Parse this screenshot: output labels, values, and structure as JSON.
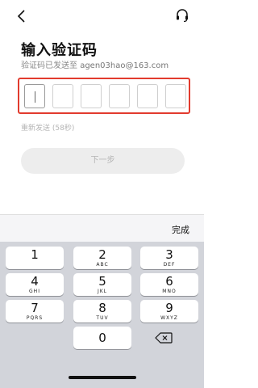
{
  "header": {
    "back_icon": "chevron-left-icon",
    "support_icon": "headset-icon"
  },
  "page": {
    "title": "输入验证码",
    "subtitle_prefix": "验证码已发送至 ",
    "email": "agen03hao@163.com",
    "resend_text": "重新发送 (58秒)",
    "next_label": "下一步"
  },
  "code": {
    "digits": [
      "",
      "",
      "",
      "",
      "",
      ""
    ]
  },
  "keyboard": {
    "done_label": "完成",
    "keys": [
      {
        "num": "1",
        "letters": ""
      },
      {
        "num": "2",
        "letters": "ABC"
      },
      {
        "num": "3",
        "letters": "DEF"
      },
      {
        "num": "4",
        "letters": "GHI"
      },
      {
        "num": "5",
        "letters": "JKL"
      },
      {
        "num": "6",
        "letters": "MNO"
      },
      {
        "num": "7",
        "letters": "PQRS"
      },
      {
        "num": "8",
        "letters": "TUV"
      },
      {
        "num": "9",
        "letters": "WXYZ"
      },
      {
        "num": "0",
        "letters": ""
      }
    ],
    "backspace_icon": "backspace-icon"
  },
  "colors": {
    "highlight_border": "#e23b2e",
    "keyboard_bg": "#d2d4da"
  }
}
